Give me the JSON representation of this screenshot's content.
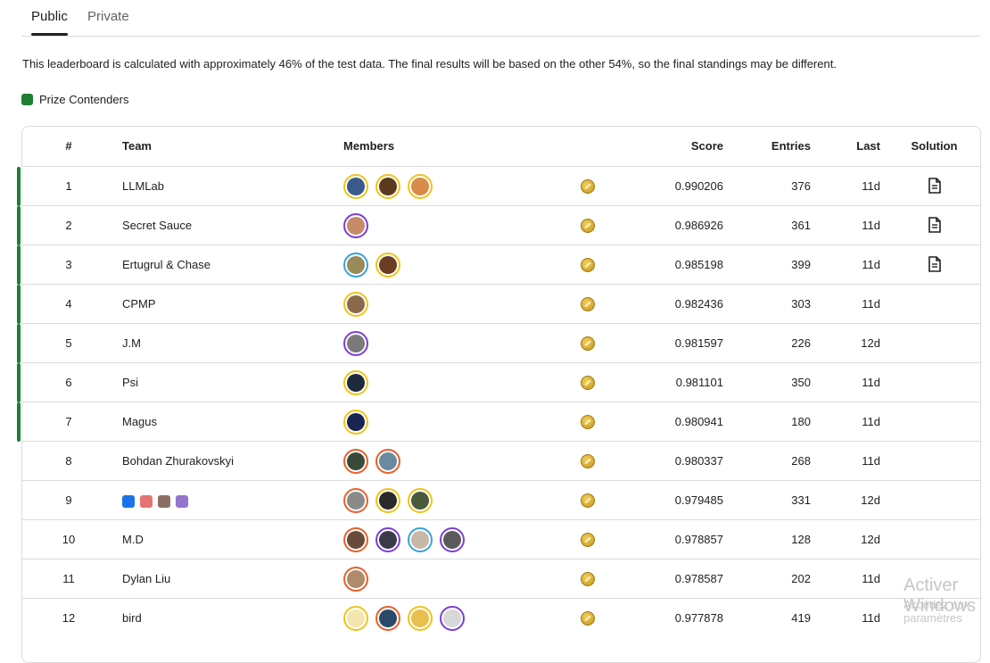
{
  "tabs": [
    {
      "label": "Public",
      "active": true
    },
    {
      "label": "Private",
      "active": false
    }
  ],
  "notice": "This leaderboard is calculated with approximately 46% of the test data. The final results will be based on the other 54%, so the final standings may be different.",
  "legend": {
    "label": "Prize Contenders",
    "color": "#1e7e34"
  },
  "table": {
    "headers": {
      "rank": "#",
      "team": "Team",
      "members": "Members",
      "score": "Score",
      "entries": "Entries",
      "last": "Last",
      "solution": "Solution"
    },
    "rows": [
      {
        "rank": "1",
        "team": "LLMLab",
        "score": "0.990206",
        "entries": "376",
        "last": "11d",
        "solution": true,
        "prize": true,
        "medal": "gold",
        "members": [
          {
            "ring": "#f0c419",
            "fill": "#3a5a8c"
          },
          {
            "ring": "#f0c419",
            "fill": "#5b3a1e"
          },
          {
            "ring": "#f0c419",
            "fill": "#d98b4a"
          }
        ]
      },
      {
        "rank": "2",
        "team": "Secret Sauce",
        "score": "0.986926",
        "entries": "361",
        "last": "11d",
        "solution": true,
        "prize": true,
        "medal": "gold",
        "members": [
          {
            "ring": "#7b3fd6",
            "fill": "#c98a6a"
          }
        ]
      },
      {
        "rank": "3",
        "team": "Ertugrul & Chase",
        "score": "0.985198",
        "entries": "399",
        "last": "11d",
        "solution": true,
        "prize": true,
        "medal": "gold",
        "members": [
          {
            "ring": "#38a3d9",
            "fill": "#9a8a5a"
          },
          {
            "ring": "#f0c419",
            "fill": "#6b3c22"
          }
        ]
      },
      {
        "rank": "4",
        "team": "CPMP",
        "score": "0.982436",
        "entries": "303",
        "last": "11d",
        "solution": false,
        "prize": true,
        "medal": "gold",
        "members": [
          {
            "ring": "#f0c419",
            "fill": "#8a6a4a"
          }
        ]
      },
      {
        "rank": "5",
        "team": "J.M",
        "score": "0.981597",
        "entries": "226",
        "last": "12d",
        "solution": false,
        "prize": true,
        "medal": "gold",
        "members": [
          {
            "ring": "#7b3fd6",
            "fill": "#7a7a7a"
          }
        ]
      },
      {
        "rank": "6",
        "team": "Psi",
        "score": "0.981101",
        "entries": "350",
        "last": "11d",
        "solution": false,
        "prize": true,
        "medal": "gold",
        "members": [
          {
            "ring": "#f0c419",
            "fill": "#1d2a3a"
          }
        ]
      },
      {
        "rank": "7",
        "team": "Magus",
        "score": "0.980941",
        "entries": "180",
        "last": "11d",
        "solution": false,
        "prize": true,
        "medal": "gold",
        "members": [
          {
            "ring": "#f0c419",
            "fill": "#1a2450"
          }
        ]
      },
      {
        "rank": "8",
        "team": "Bohdan Zhurakovskyi",
        "score": "0.980337",
        "entries": "268",
        "last": "11d",
        "solution": false,
        "prize": false,
        "medal": "gold",
        "members": [
          {
            "ring": "#e8602c",
            "fill": "#3a4a3a"
          },
          {
            "ring": "#e8602c",
            "fill": "#6a8aa0"
          }
        ]
      },
      {
        "rank": "9",
        "team": "🔍 📝 🕵 👾",
        "team_emojis": [
          "#1a73e8",
          "#e57373",
          "#8d6e63",
          "#9575cd"
        ],
        "score": "0.979485",
        "entries": "331",
        "last": "12d",
        "solution": false,
        "prize": false,
        "medal": "gold",
        "members": [
          {
            "ring": "#e8602c",
            "fill": "#8a8a8a"
          },
          {
            "ring": "#f0c419",
            "fill": "#2a2a2a"
          },
          {
            "ring": "#f0c419",
            "fill": "#4a5a3a"
          }
        ]
      },
      {
        "rank": "10",
        "team": "M.D",
        "score": "0.978857",
        "entries": "128",
        "last": "12d",
        "solution": false,
        "prize": false,
        "medal": "gold",
        "members": [
          {
            "ring": "#e8602c",
            "fill": "#6a4a3a"
          },
          {
            "ring": "#7b3fd6",
            "fill": "#3a3a4a"
          },
          {
            "ring": "#38a3d9",
            "fill": "#c8b8a8"
          },
          {
            "ring": "#7b3fd6",
            "fill": "#5a5a5a"
          }
        ]
      },
      {
        "rank": "11",
        "team": "Dylan Liu",
        "score": "0.978587",
        "entries": "202",
        "last": "11d",
        "solution": false,
        "prize": false,
        "medal": "gold",
        "members": [
          {
            "ring": "#e8602c",
            "fill": "#b08a6a"
          }
        ]
      },
      {
        "rank": "12",
        "team": "bird",
        "score": "0.977878",
        "entries": "419",
        "last": "11d",
        "solution": false,
        "prize": false,
        "medal": "gold",
        "members": [
          {
            "ring": "#f0c419",
            "fill": "#f4e6b0"
          },
          {
            "ring": "#e8602c",
            "fill": "#2a4a6a"
          },
          {
            "ring": "#f0c419",
            "fill": "#e8c050"
          },
          {
            "ring": "#7b3fd6",
            "fill": "#d8d8d8"
          }
        ]
      }
    ]
  },
  "watermark": {
    "title": "Activer Windows",
    "subtitle": "Accédez aux paramètres"
  }
}
